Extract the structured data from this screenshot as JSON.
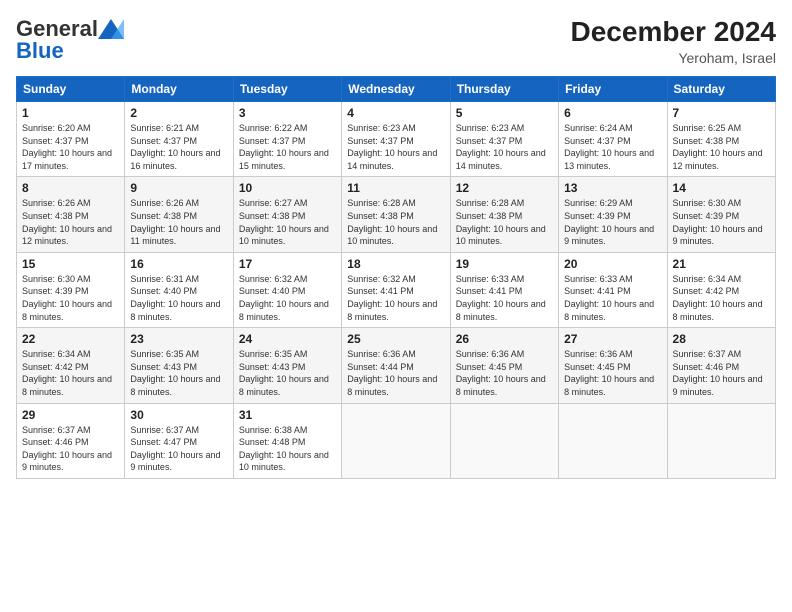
{
  "header": {
    "logo_line1": "General",
    "logo_line2": "Blue",
    "month_title": "December 2024",
    "location": "Yeroham, Israel"
  },
  "days_of_week": [
    "Sunday",
    "Monday",
    "Tuesday",
    "Wednesday",
    "Thursday",
    "Friday",
    "Saturday"
  ],
  "weeks": [
    [
      {
        "day": "1",
        "sunrise": "6:20 AM",
        "sunset": "4:37 PM",
        "daylight": "10 hours and 17 minutes."
      },
      {
        "day": "2",
        "sunrise": "6:21 AM",
        "sunset": "4:37 PM",
        "daylight": "10 hours and 16 minutes."
      },
      {
        "day": "3",
        "sunrise": "6:22 AM",
        "sunset": "4:37 PM",
        "daylight": "10 hours and 15 minutes."
      },
      {
        "day": "4",
        "sunrise": "6:23 AM",
        "sunset": "4:37 PM",
        "daylight": "10 hours and 14 minutes."
      },
      {
        "day": "5",
        "sunrise": "6:23 AM",
        "sunset": "4:37 PM",
        "daylight": "10 hours and 14 minutes."
      },
      {
        "day": "6",
        "sunrise": "6:24 AM",
        "sunset": "4:37 PM",
        "daylight": "10 hours and 13 minutes."
      },
      {
        "day": "7",
        "sunrise": "6:25 AM",
        "sunset": "4:38 PM",
        "daylight": "10 hours and 12 minutes."
      }
    ],
    [
      {
        "day": "8",
        "sunrise": "6:26 AM",
        "sunset": "4:38 PM",
        "daylight": "10 hours and 12 minutes."
      },
      {
        "day": "9",
        "sunrise": "6:26 AM",
        "sunset": "4:38 PM",
        "daylight": "10 hours and 11 minutes."
      },
      {
        "day": "10",
        "sunrise": "6:27 AM",
        "sunset": "4:38 PM",
        "daylight": "10 hours and 10 minutes."
      },
      {
        "day": "11",
        "sunrise": "6:28 AM",
        "sunset": "4:38 PM",
        "daylight": "10 hours and 10 minutes."
      },
      {
        "day": "12",
        "sunrise": "6:28 AM",
        "sunset": "4:38 PM",
        "daylight": "10 hours and 10 minutes."
      },
      {
        "day": "13",
        "sunrise": "6:29 AM",
        "sunset": "4:39 PM",
        "daylight": "10 hours and 9 minutes."
      },
      {
        "day": "14",
        "sunrise": "6:30 AM",
        "sunset": "4:39 PM",
        "daylight": "10 hours and 9 minutes."
      }
    ],
    [
      {
        "day": "15",
        "sunrise": "6:30 AM",
        "sunset": "4:39 PM",
        "daylight": "10 hours and 8 minutes."
      },
      {
        "day": "16",
        "sunrise": "6:31 AM",
        "sunset": "4:40 PM",
        "daylight": "10 hours and 8 minutes."
      },
      {
        "day": "17",
        "sunrise": "6:32 AM",
        "sunset": "4:40 PM",
        "daylight": "10 hours and 8 minutes."
      },
      {
        "day": "18",
        "sunrise": "6:32 AM",
        "sunset": "4:41 PM",
        "daylight": "10 hours and 8 minutes."
      },
      {
        "day": "19",
        "sunrise": "6:33 AM",
        "sunset": "4:41 PM",
        "daylight": "10 hours and 8 minutes."
      },
      {
        "day": "20",
        "sunrise": "6:33 AM",
        "sunset": "4:41 PM",
        "daylight": "10 hours and 8 minutes."
      },
      {
        "day": "21",
        "sunrise": "6:34 AM",
        "sunset": "4:42 PM",
        "daylight": "10 hours and 8 minutes."
      }
    ],
    [
      {
        "day": "22",
        "sunrise": "6:34 AM",
        "sunset": "4:42 PM",
        "daylight": "10 hours and 8 minutes."
      },
      {
        "day": "23",
        "sunrise": "6:35 AM",
        "sunset": "4:43 PM",
        "daylight": "10 hours and 8 minutes."
      },
      {
        "day": "24",
        "sunrise": "6:35 AM",
        "sunset": "4:43 PM",
        "daylight": "10 hours and 8 minutes."
      },
      {
        "day": "25",
        "sunrise": "6:36 AM",
        "sunset": "4:44 PM",
        "daylight": "10 hours and 8 minutes."
      },
      {
        "day": "26",
        "sunrise": "6:36 AM",
        "sunset": "4:45 PM",
        "daylight": "10 hours and 8 minutes."
      },
      {
        "day": "27",
        "sunrise": "6:36 AM",
        "sunset": "4:45 PM",
        "daylight": "10 hours and 8 minutes."
      },
      {
        "day": "28",
        "sunrise": "6:37 AM",
        "sunset": "4:46 PM",
        "daylight": "10 hours and 9 minutes."
      }
    ],
    [
      {
        "day": "29",
        "sunrise": "6:37 AM",
        "sunset": "4:46 PM",
        "daylight": "10 hours and 9 minutes."
      },
      {
        "day": "30",
        "sunrise": "6:37 AM",
        "sunset": "4:47 PM",
        "daylight": "10 hours and 9 minutes."
      },
      {
        "day": "31",
        "sunrise": "6:38 AM",
        "sunset": "4:48 PM",
        "daylight": "10 hours and 10 minutes."
      },
      null,
      null,
      null,
      null
    ]
  ],
  "labels": {
    "sunrise": "Sunrise:",
    "sunset": "Sunset:",
    "daylight": "Daylight:"
  }
}
